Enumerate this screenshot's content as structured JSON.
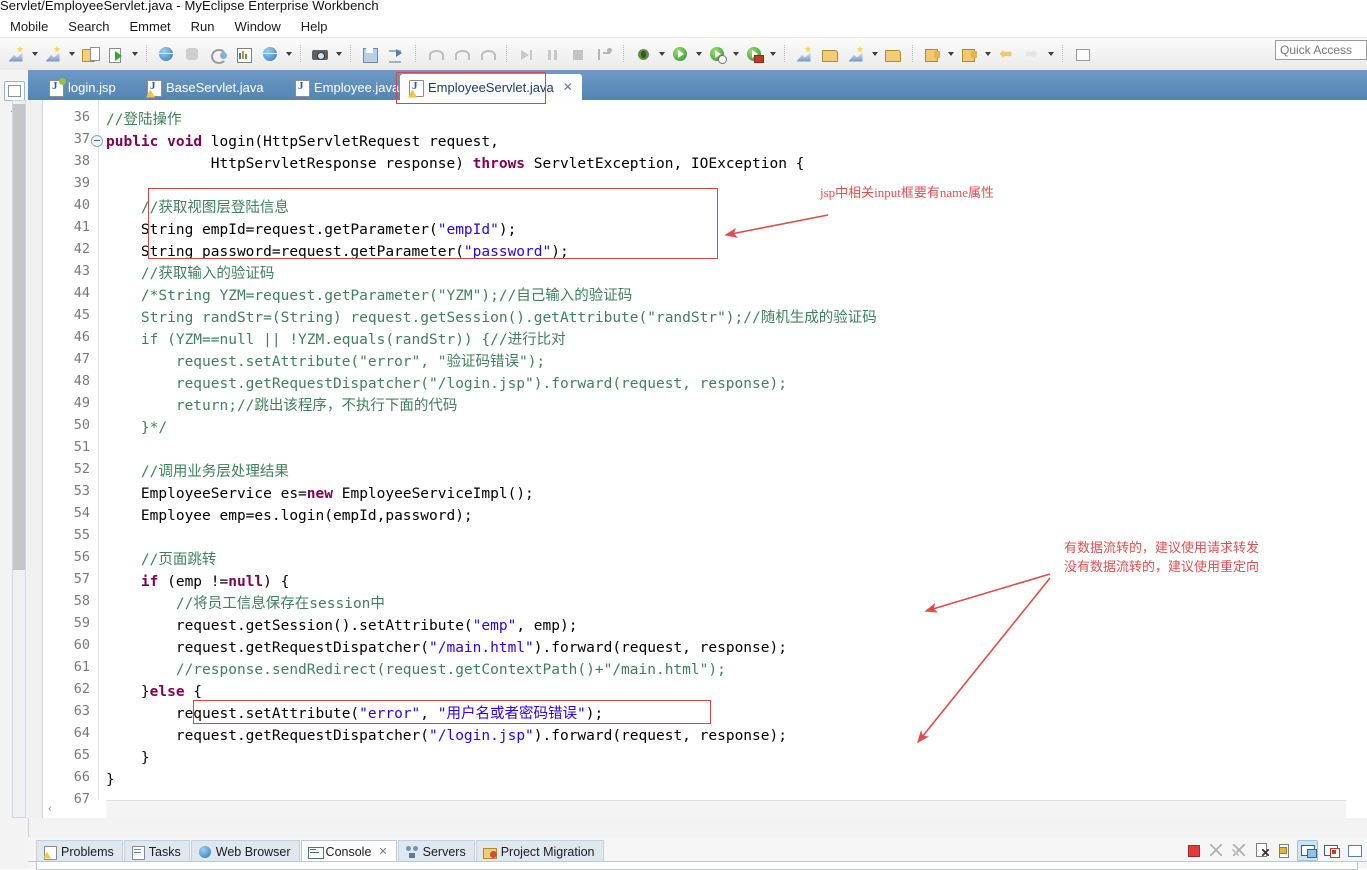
{
  "window": {
    "title": "Servlet/EmployeeServlet.java - MyEclipse Enterprise Workbench"
  },
  "menu": {
    "items": [
      {
        "label": "Mobile"
      },
      {
        "label": "Search"
      },
      {
        "label": "Emmet"
      },
      {
        "label": "Run"
      },
      {
        "label": "Window"
      },
      {
        "label": "Help"
      }
    ]
  },
  "toolbar": {
    "groups": [
      {
        "buttons": [
          {
            "icon": "new-myeclipse-wizard-icon",
            "dropdown": true
          },
          {
            "icon": "new-web-project-icon",
            "dropdown": true
          },
          {
            "icon": "import-project-icon",
            "dropdown": false
          },
          {
            "icon": "deploy-run-icon",
            "dropdown": true
          }
        ]
      },
      {
        "buttons": [
          {
            "icon": "open-browser-icon",
            "dropdown": false
          },
          {
            "icon": "database-explorer-icon",
            "dropdown": false
          },
          {
            "icon": "refresh-deploy-icon",
            "dropdown": false
          },
          {
            "icon": "report-designer-icon",
            "dropdown": false
          },
          {
            "icon": "web-services-icon",
            "dropdown": true
          }
        ]
      },
      {
        "buttons": [
          {
            "icon": "snapshot-camera-icon",
            "dropdown": true
          }
        ]
      },
      {
        "buttons": [
          {
            "icon": "save-all-icon",
            "dropdown": false
          },
          {
            "icon": "publish-icon",
            "dropdown": false
          }
        ]
      },
      {
        "buttons": [
          {
            "icon": "undo-step-icon",
            "dropdown": false
          },
          {
            "icon": "redo-step-icon",
            "dropdown": false
          },
          {
            "icon": "step-into-icon",
            "dropdown": false
          }
        ]
      },
      {
        "buttons": [
          {
            "icon": "resume-icon",
            "dropdown": false
          },
          {
            "icon": "suspend-icon",
            "dropdown": false
          },
          {
            "icon": "terminate-icon",
            "dropdown": false
          },
          {
            "icon": "step-filters-icon",
            "dropdown": false
          }
        ]
      },
      {
        "buttons": [
          {
            "icon": "debug-bug-icon",
            "dropdown": true
          },
          {
            "icon": "run-play-icon",
            "dropdown": true
          },
          {
            "icon": "run-history-icon",
            "dropdown": true
          },
          {
            "icon": "run-external-tools-icon",
            "dropdown": true
          }
        ]
      },
      {
        "buttons": [
          {
            "icon": "new-java-package-icon",
            "dropdown": false
          },
          {
            "icon": "open-type-icon",
            "dropdown": false
          },
          {
            "icon": "new-class-icon",
            "dropdown": true
          },
          {
            "icon": "open-resource-icon",
            "dropdown": false
          }
        ]
      },
      {
        "buttons": [
          {
            "icon": "next-annotation-icon",
            "dropdown": true
          },
          {
            "icon": "previous-annotation-icon",
            "dropdown": true
          },
          {
            "icon": "back-navigation-icon",
            "dropdown": false
          },
          {
            "icon": "forward-navigation-icon",
            "dropdown": true
          }
        ]
      },
      {
        "buttons": [
          {
            "icon": "pin-editor-icon",
            "dropdown": false
          }
        ]
      }
    ],
    "quick_access_placeholder": "Quick Access"
  },
  "editor_tabs": {
    "items": [
      {
        "label": "login.jsp",
        "icon": "jsp-file-icon",
        "active": false,
        "warning": false
      },
      {
        "label": "BaseServlet.java",
        "icon": "java-file-icon",
        "active": false,
        "warning": true
      },
      {
        "label": "Employee.java",
        "icon": "java-file-icon",
        "active": false,
        "warning": false
      },
      {
        "label": "EmployeeServlet.java",
        "icon": "java-file-icon",
        "active": true,
        "warning": true,
        "close_glyph": "✕"
      }
    ]
  },
  "code": {
    "first_line_number": 36,
    "fold_marker_line": 37,
    "lines": [
      {
        "n": 36,
        "indent": 8,
        "tokens": [
          {
            "t": "//登陆操作",
            "c": "cmt"
          }
        ]
      },
      {
        "n": 37,
        "indent": 8,
        "tokens": [
          {
            "t": "public",
            "c": "kw"
          },
          {
            "t": " ",
            "c": "pl"
          },
          {
            "t": "void",
            "c": "kw"
          },
          {
            "t": " login(HttpServletRequest request,",
            "c": "pl"
          }
        ]
      },
      {
        "n": 38,
        "indent": 8,
        "tokens": [
          {
            "t": "            HttpServletResponse response) ",
            "c": "pl"
          },
          {
            "t": "throws",
            "c": "kw"
          },
          {
            "t": " ServletException, IOException {",
            "c": "pl"
          }
        ]
      },
      {
        "n": 39,
        "indent": 8,
        "tokens": []
      },
      {
        "n": 40,
        "indent": 8,
        "tokens": [
          {
            "t": "    //获取视图层登陆信息",
            "c": "cmt"
          }
        ]
      },
      {
        "n": 41,
        "indent": 8,
        "tokens": [
          {
            "t": "    String empId=request.getParameter(",
            "c": "pl"
          },
          {
            "t": "\"empId\"",
            "c": "str"
          },
          {
            "t": ");",
            "c": "pl"
          }
        ]
      },
      {
        "n": 42,
        "indent": 8,
        "tokens": [
          {
            "t": "    String password=request.getParameter(",
            "c": "pl"
          },
          {
            "t": "\"password\"",
            "c": "str"
          },
          {
            "t": ");",
            "c": "pl"
          }
        ]
      },
      {
        "n": 43,
        "indent": 8,
        "tokens": [
          {
            "t": "    //获取输入的验证码",
            "c": "cmt"
          }
        ]
      },
      {
        "n": 44,
        "indent": 8,
        "tokens": [
          {
            "t": "    /*String YZM=request.getParameter(\"YZM\");//自己输入的验证码",
            "c": "cmt"
          }
        ]
      },
      {
        "n": 45,
        "indent": 8,
        "tokens": [
          {
            "t": "    String randStr=(String) request.getSession().getAttribute(\"randStr\");//随机生成的验证码",
            "c": "cmt"
          }
        ]
      },
      {
        "n": 46,
        "indent": 8,
        "tokens": [
          {
            "t": "    if (YZM==null || !YZM.equals(randStr)) {//进行比对",
            "c": "cmt"
          }
        ]
      },
      {
        "n": 47,
        "indent": 8,
        "tokens": [
          {
            "t": "        request.setAttribute(\"error\", \"验证码错误\");",
            "c": "cmt"
          }
        ]
      },
      {
        "n": 48,
        "indent": 8,
        "tokens": [
          {
            "t": "        request.getRequestDispatcher(\"/login.jsp\").forward(request, response);",
            "c": "cmt"
          }
        ]
      },
      {
        "n": 49,
        "indent": 8,
        "tokens": [
          {
            "t": "        return;//跳出该程序，不执行下面的代码",
            "c": "cmt"
          }
        ]
      },
      {
        "n": 50,
        "indent": 8,
        "tokens": [
          {
            "t": "    }*/",
            "c": "cmt"
          }
        ]
      },
      {
        "n": 51,
        "indent": 8,
        "tokens": []
      },
      {
        "n": 52,
        "indent": 8,
        "tokens": [
          {
            "t": "    //调用业务层处理结果",
            "c": "cmt"
          }
        ]
      },
      {
        "n": 53,
        "indent": 8,
        "tokens": [
          {
            "t": "    EmployeeService es=",
            "c": "pl"
          },
          {
            "t": "new",
            "c": "kw"
          },
          {
            "t": " EmployeeServiceImpl();",
            "c": "pl"
          }
        ]
      },
      {
        "n": 54,
        "indent": 8,
        "tokens": [
          {
            "t": "    Employee emp=es.login(empId,password);",
            "c": "pl"
          }
        ]
      },
      {
        "n": 55,
        "indent": 8,
        "tokens": []
      },
      {
        "n": 56,
        "indent": 8,
        "tokens": [
          {
            "t": "    //页面跳转",
            "c": "cmt"
          }
        ]
      },
      {
        "n": 57,
        "indent": 8,
        "tokens": [
          {
            "t": "    ",
            "c": "pl"
          },
          {
            "t": "if",
            "c": "kw"
          },
          {
            "t": " (emp !=",
            "c": "pl"
          },
          {
            "t": "null",
            "c": "kw"
          },
          {
            "t": ") {",
            "c": "pl"
          }
        ]
      },
      {
        "n": 58,
        "indent": 8,
        "tokens": [
          {
            "t": "        //将员工信息保存在session中",
            "c": "cmt"
          }
        ]
      },
      {
        "n": 59,
        "indent": 8,
        "tokens": [
          {
            "t": "        request.getSession().setAttribute(",
            "c": "pl"
          },
          {
            "t": "\"emp\"",
            "c": "str"
          },
          {
            "t": ", emp);",
            "c": "pl"
          }
        ]
      },
      {
        "n": 60,
        "indent": 8,
        "tokens": [
          {
            "t": "        request.getRequestDispatcher(",
            "c": "pl"
          },
          {
            "t": "\"/main.html\"",
            "c": "str"
          },
          {
            "t": ").forward(request, response);",
            "c": "pl"
          }
        ]
      },
      {
        "n": 61,
        "indent": 8,
        "tokens": [
          {
            "t": "        //response.sendRedirect(request.getContextPath()+\"/main.html\");",
            "c": "cmt"
          }
        ]
      },
      {
        "n": 62,
        "indent": 8,
        "tokens": [
          {
            "t": "    }",
            "c": "pl"
          },
          {
            "t": "else",
            "c": "kw"
          },
          {
            "t": " {",
            "c": "pl"
          }
        ]
      },
      {
        "n": 63,
        "indent": 8,
        "tokens": [
          {
            "t": "        request.setAttribute(",
            "c": "pl"
          },
          {
            "t": "\"error\"",
            "c": "str"
          },
          {
            "t": ", ",
            "c": "pl"
          },
          {
            "t": "\"用户名或者密码错误\"",
            "c": "str"
          },
          {
            "t": ");",
            "c": "pl"
          }
        ]
      },
      {
        "n": 64,
        "indent": 8,
        "tokens": [
          {
            "t": "        request.getRequestDispatcher(",
            "c": "pl"
          },
          {
            "t": "\"/login.jsp\"",
            "c": "str"
          },
          {
            "t": ").forward(request, response);",
            "c": "pl"
          }
        ]
      },
      {
        "n": 65,
        "indent": 8,
        "tokens": [
          {
            "t": "    }",
            "c": "pl"
          }
        ]
      },
      {
        "n": 66,
        "indent": 8,
        "tokens": [
          {
            "t": "}",
            "c": "pl"
          }
        ]
      },
      {
        "n": 67,
        "indent": 8,
        "tokens": []
      }
    ]
  },
  "annotations": {
    "color": "#e05050",
    "notes": [
      {
        "id": "note-input-name",
        "text": "jsp中相关input框要有name属性"
      },
      {
        "id": "note-forward-redirect",
        "text": "有数据流转的，建议使用请求转发\n没有数据流转的，建议使用重定向"
      }
    ]
  },
  "bottom_views": {
    "tabs": [
      {
        "label": "Problems",
        "icon": "problems-icon",
        "active": false
      },
      {
        "label": "Tasks",
        "icon": "tasks-icon",
        "active": false
      },
      {
        "label": "Web Browser",
        "icon": "web-browser-icon",
        "active": false
      },
      {
        "label": "Console",
        "icon": "console-icon",
        "active": true,
        "close_glyph": "✕"
      },
      {
        "label": "Servers",
        "icon": "servers-icon",
        "active": false
      },
      {
        "label": "Project Migration",
        "icon": "project-migration-icon",
        "active": false
      }
    ],
    "toolbar_buttons": [
      {
        "icon": "terminate-stop-icon",
        "active": false
      },
      {
        "icon": "remove-launch-icon",
        "active": false
      },
      {
        "icon": "remove-all-terminated-icon",
        "active": false
      },
      {
        "icon": "clear-console-icon",
        "active": false
      },
      {
        "icon": "scroll-lock-icon",
        "active": false
      },
      {
        "icon": "show-console-on-output-icon",
        "active": true
      },
      {
        "icon": "show-console-on-error-icon",
        "active": false
      },
      {
        "icon": "open-console-icon",
        "active": false
      }
    ]
  }
}
